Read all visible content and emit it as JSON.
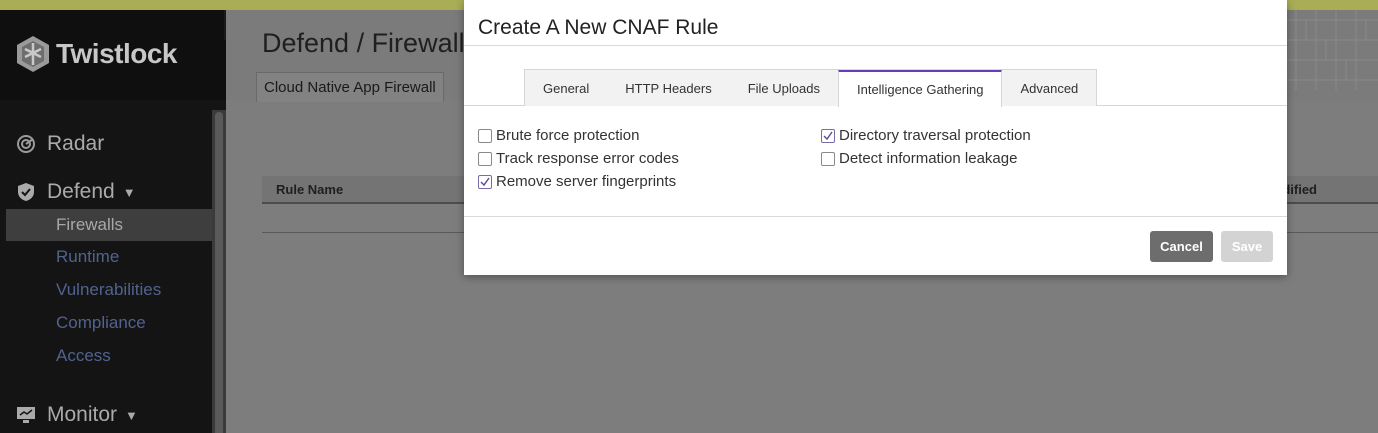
{
  "brand": {
    "name": "Twistlock"
  },
  "sidebar": {
    "sections": [
      {
        "label": "Radar",
        "icon": "radar-icon"
      },
      {
        "label": "Defend",
        "icon": "shield-icon",
        "expanded": true
      },
      {
        "label": "Monitor",
        "icon": "monitor-icon",
        "expanded": false
      }
    ],
    "defend_items": [
      {
        "label": "Firewalls",
        "active": true
      },
      {
        "label": "Runtime"
      },
      {
        "label": "Vulnerabilities"
      },
      {
        "label": "Compliance"
      },
      {
        "label": "Access"
      }
    ]
  },
  "page": {
    "title": "Defend / Firewalls",
    "subtab": "Cloud Native App Firewall",
    "table": {
      "col_rule_name": "Rule Name",
      "col_modified": "dified"
    }
  },
  "modal": {
    "title": "Create A New CNAF Rule",
    "tabs": [
      {
        "label": "General"
      },
      {
        "label": "HTTP Headers"
      },
      {
        "label": "File Uploads"
      },
      {
        "label": "Intelligence Gathering",
        "active": true
      },
      {
        "label": "Advanced"
      }
    ],
    "options_left": [
      {
        "label": "Brute force protection",
        "checked": false
      },
      {
        "label": "Track response error codes",
        "checked": false
      },
      {
        "label": "Remove server fingerprints",
        "checked": true
      }
    ],
    "options_right": [
      {
        "label": "Directory traversal protection",
        "checked": true
      },
      {
        "label": "Detect information leakage",
        "checked": false
      }
    ],
    "cancel_label": "Cancel",
    "save_label": "Save"
  },
  "colors": {
    "accent": "#6a3eb3",
    "topbar": "#a8ad56",
    "link": "#51638d"
  }
}
